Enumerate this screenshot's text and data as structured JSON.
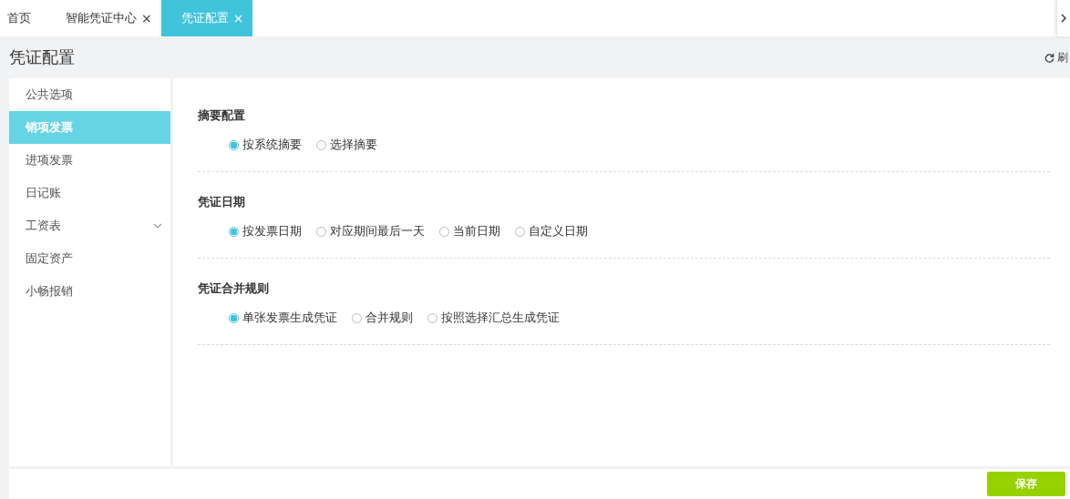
{
  "tabs": [
    {
      "label": "首页",
      "closable": false,
      "selected": false
    },
    {
      "label": "智能凭证中心",
      "closable": true,
      "selected": false
    },
    {
      "label": "凭证配置",
      "closable": true,
      "selected": true
    }
  ],
  "close_glyph": "×",
  "page_title": "凭证配置",
  "refresh_label": "刷",
  "sidebar": {
    "items": [
      {
        "label": "公共选项",
        "selected": false,
        "expandable": false
      },
      {
        "label": "销项发票",
        "selected": true,
        "expandable": false
      },
      {
        "label": "进项发票",
        "selected": false,
        "expandable": false
      },
      {
        "label": "日记账",
        "selected": false,
        "expandable": false
      },
      {
        "label": "工资表",
        "selected": false,
        "expandable": true
      },
      {
        "label": "固定资产",
        "selected": false,
        "expandable": false
      },
      {
        "label": "小畅报销",
        "selected": false,
        "expandable": false
      }
    ]
  },
  "sections": [
    {
      "title": "摘要配置",
      "options": [
        {
          "label": "按系统摘要",
          "selected": true
        },
        {
          "label": "选择摘要",
          "selected": false
        }
      ]
    },
    {
      "title": "凭证日期",
      "options": [
        {
          "label": "按发票日期",
          "selected": true
        },
        {
          "label": "对应期间最后一天",
          "selected": false
        },
        {
          "label": "当前日期",
          "selected": false
        },
        {
          "label": "自定义日期",
          "selected": false
        }
      ]
    },
    {
      "title": "凭证合并规则",
      "options": [
        {
          "label": "单张发票生成凭证",
          "selected": true
        },
        {
          "label": "合并规则",
          "selected": false
        },
        {
          "label": "按照选择汇总生成凭证",
          "selected": false
        }
      ]
    }
  ],
  "save_button": "保存"
}
